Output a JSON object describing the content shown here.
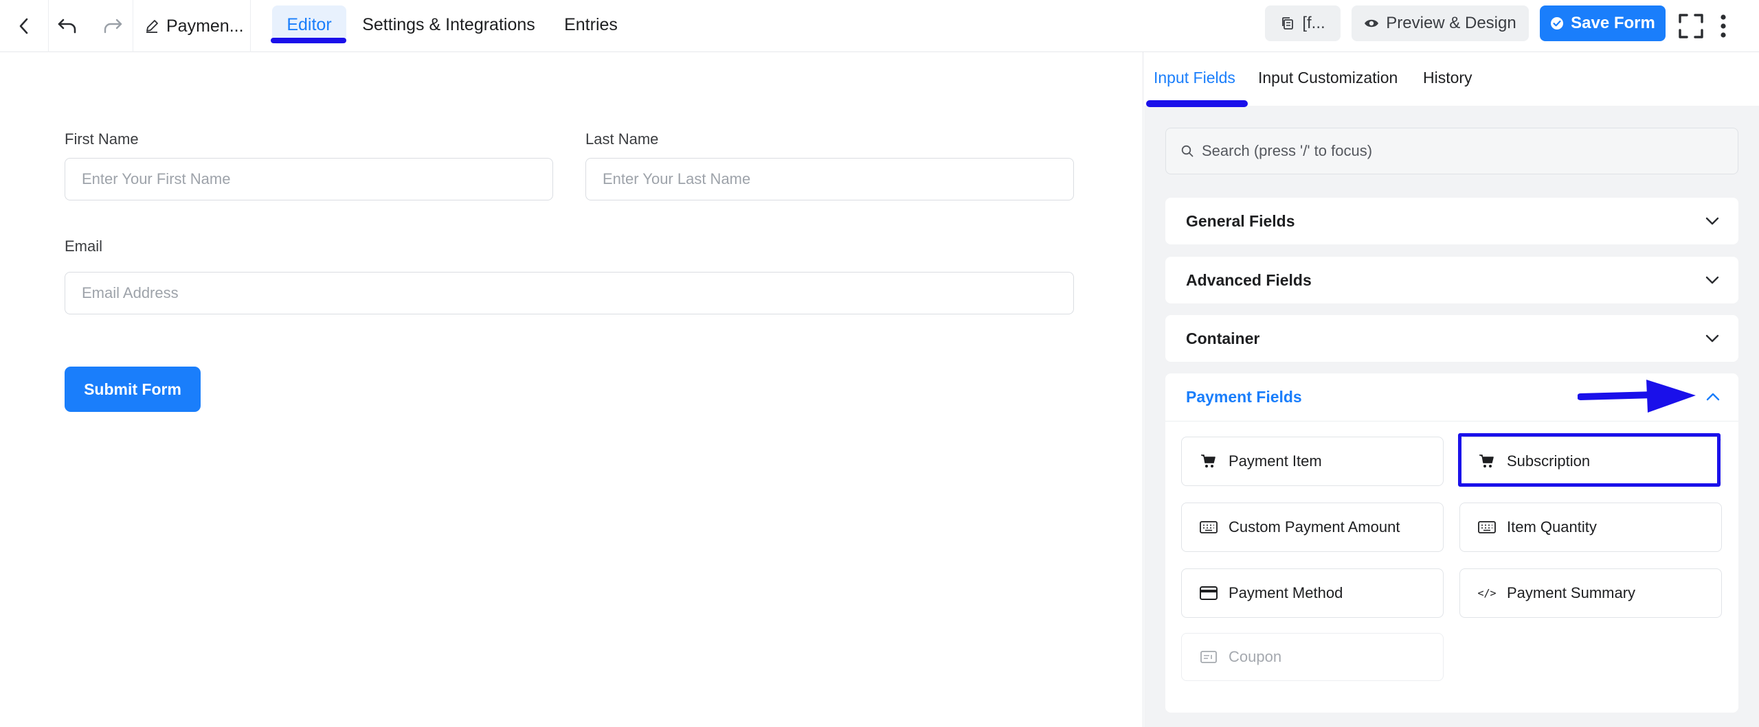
{
  "topbar": {
    "form_name": "Paymen...",
    "tabs": [
      {
        "label": "Editor"
      },
      {
        "label": "Settings & Integrations"
      },
      {
        "label": "Entries"
      }
    ],
    "shortcode_label": "[f...",
    "preview_label": "Preview & Design",
    "save_label": "Save Form"
  },
  "form": {
    "first_name": {
      "label": "First Name",
      "placeholder": "Enter Your First Name"
    },
    "last_name": {
      "label": "Last Name",
      "placeholder": "Enter Your Last Name"
    },
    "email": {
      "label": "Email",
      "placeholder": "Email Address"
    },
    "submit_label": "Submit Form"
  },
  "sidebar": {
    "tabs": [
      {
        "label": "Input Fields"
      },
      {
        "label": "Input Customization"
      },
      {
        "label": "History"
      }
    ],
    "search_placeholder": "Search (press '/' to focus)",
    "sections": [
      {
        "label": "General Fields"
      },
      {
        "label": "Advanced Fields"
      },
      {
        "label": "Container"
      }
    ],
    "payment": {
      "label": "Payment Fields",
      "items": [
        {
          "label": "Payment Item",
          "icon": "cart-icon"
        },
        {
          "label": "Subscription",
          "icon": "cart-icon"
        },
        {
          "label": "Custom Payment Amount",
          "icon": "keyboard-icon"
        },
        {
          "label": "Item Quantity",
          "icon": "keyboard-icon"
        },
        {
          "label": "Payment Method",
          "icon": "credit-card-icon"
        },
        {
          "label": "Payment Summary",
          "icon": "code-icon",
          "glyph": "</>"
        },
        {
          "label": "Coupon",
          "icon": "coupon-icon"
        }
      ]
    }
  },
  "colors": {
    "accent": "#1a7efb",
    "annotation": "#1a10ea"
  }
}
